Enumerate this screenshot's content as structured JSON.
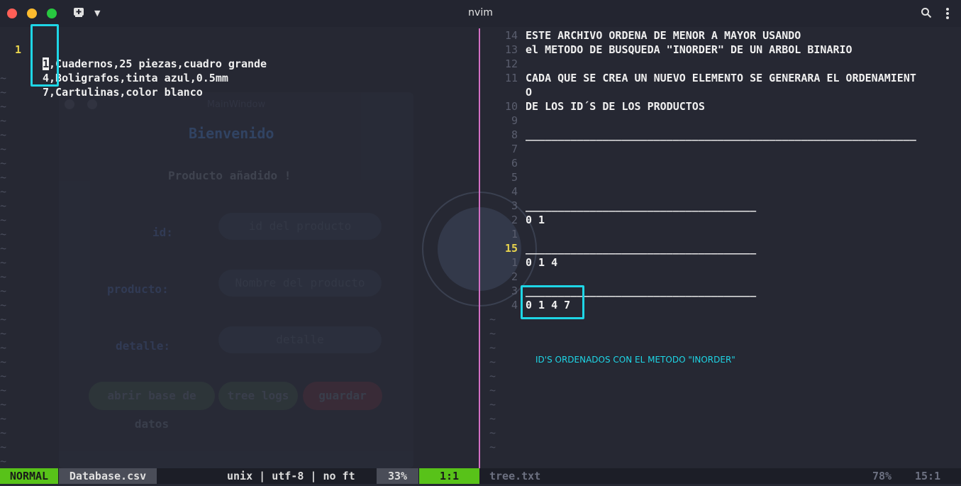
{
  "window": {
    "title": "nvim"
  },
  "left_pane": {
    "lines": [
      {
        "num": "1",
        "text_head": "1",
        "text_rest": ",Cuadernos,25 piezas,cuadro grande"
      },
      {
        "num": "",
        "text_head": "4",
        "text_rest": ",Boligrafos,tinta azul,0.5mm"
      },
      {
        "num": "",
        "text_head": "7",
        "text_rest": ",Cartulinas,color blanco"
      }
    ],
    "tilde": "~"
  },
  "right_pane": {
    "lines": [
      {
        "num": "14",
        "text": "ESTE ARCHIVO ORDENA DE MENOR A MAYOR USANDO"
      },
      {
        "num": "13",
        "text": "el METODO DE BUSQUEDA \"INORDER\" DE UN ARBOL BINARIO"
      },
      {
        "num": "12",
        "text": ""
      },
      {
        "num": "11",
        "text": "CADA QUE SE CREA UN NUEVO ELEMENTO SE GENERARA EL ORDENAMIENT"
      },
      {
        "num": "",
        "text": "O"
      },
      {
        "num": "10",
        "text": "DE LOS ID´S DE LOS PRODUCTOS"
      },
      {
        "num": "9",
        "text": ""
      },
      {
        "num": "8",
        "text": "_____________________________________________________________"
      },
      {
        "num": "7",
        "text": ""
      },
      {
        "num": "6",
        "text": ""
      },
      {
        "num": "5",
        "text": ""
      },
      {
        "num": "4",
        "text": ""
      },
      {
        "num": "3",
        "text": "____________________________________"
      },
      {
        "num": "2",
        "text": "0 1"
      },
      {
        "num": "1",
        "text": ""
      },
      {
        "num": "15",
        "text": "____________________________________"
      },
      {
        "num": "1",
        "text": "0 1 4"
      },
      {
        "num": "2",
        "text": ""
      },
      {
        "num": "3",
        "text": "____________________________________"
      },
      {
        "num": "4",
        "text": "0 1 4 7"
      }
    ],
    "tilde": "~",
    "annotation": "ID'S ORDENADOS CON EL METODO \"INORDER\""
  },
  "background_app": {
    "window_title": "MainWindow",
    "welcome": "Bienvenido",
    "message": "Producto añadido !",
    "id_label": "id:",
    "id_placeholder": "id del producto",
    "producto_label": "producto:",
    "producto_placeholder": "Nombre del producto",
    "detalle_label": "detalle:",
    "detalle_placeholder": "detalle",
    "btn_db": "abrir base de datos",
    "btn_tree": "tree logs",
    "btn_save": "guardar"
  },
  "statusline": {
    "mode": "NORMAL",
    "filename": "Database.csv",
    "info": "unix | utf-8 | no ft",
    "percent": "33%",
    "position": "1:1",
    "right_filename": "tree.txt",
    "right_percent": "78%",
    "right_position": "15:1"
  },
  "colors": {
    "accent_highlight": "#1ed6e6",
    "mode_bg": "#58c219",
    "divider": "#d46fc4"
  }
}
